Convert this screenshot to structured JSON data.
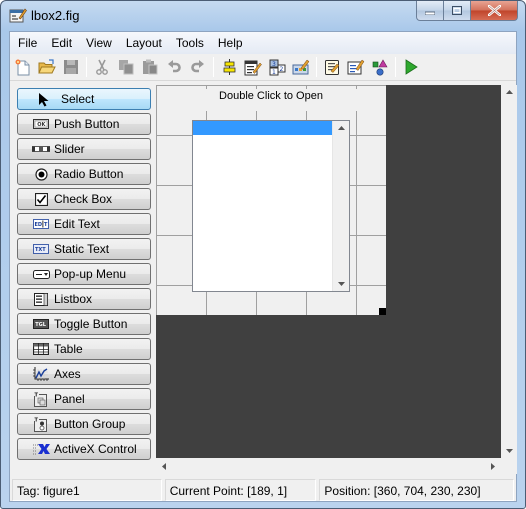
{
  "window": {
    "title": "lbox2.fig",
    "controls": {
      "minimize": "minimize",
      "maximize": "maximize",
      "close": "close"
    }
  },
  "menubar": {
    "items": [
      {
        "label": "File"
      },
      {
        "label": "Edit"
      },
      {
        "label": "View"
      },
      {
        "label": "Layout"
      },
      {
        "label": "Tools"
      },
      {
        "label": "Help"
      }
    ]
  },
  "toolbar": {
    "groups": [
      [
        {
          "name": "new-figure",
          "icon": "new-file-icon",
          "enabled": true
        },
        {
          "name": "open",
          "icon": "folder-open-icon",
          "enabled": true
        },
        {
          "name": "save",
          "icon": "save-icon",
          "enabled": false
        }
      ],
      [
        {
          "name": "cut",
          "icon": "scissors-icon",
          "enabled": false
        },
        {
          "name": "copy",
          "icon": "copy-icon",
          "enabled": false
        },
        {
          "name": "paste",
          "icon": "paste-icon",
          "enabled": false
        },
        {
          "name": "undo",
          "icon": "undo-icon",
          "enabled": false
        },
        {
          "name": "redo",
          "icon": "redo-icon",
          "enabled": false
        }
      ],
      [
        {
          "name": "align-objects",
          "icon": "align-icon",
          "enabled": true
        },
        {
          "name": "menu-editor",
          "icon": "menu-editor-icon",
          "enabled": true
        },
        {
          "name": "tab-order-editor",
          "icon": "tab-order-icon",
          "enabled": true
        },
        {
          "name": "toolbar-editor",
          "icon": "toolbar-editor-icon",
          "enabled": true
        }
      ],
      [
        {
          "name": "editor",
          "icon": "m-file-editor-icon",
          "enabled": true
        },
        {
          "name": "property-inspector",
          "icon": "property-inspector-icon",
          "enabled": true
        },
        {
          "name": "object-browser",
          "icon": "object-browser-icon",
          "enabled": true
        }
      ],
      [
        {
          "name": "run-figure",
          "icon": "run-icon",
          "enabled": true
        }
      ]
    ]
  },
  "palette": {
    "items": [
      {
        "label": "Select",
        "icon": "arrow-cursor-icon",
        "selected": true
      },
      {
        "label": "Push Button",
        "icon": "push-button-icon",
        "icon_text": "OK",
        "selected": false
      },
      {
        "label": "Slider",
        "icon": "slider-icon",
        "selected": false
      },
      {
        "label": "Radio Button",
        "icon": "radio-button-icon",
        "selected": false
      },
      {
        "label": "Check Box",
        "icon": "check-box-icon",
        "selected": false
      },
      {
        "label": "Edit Text",
        "icon": "edit-text-icon",
        "icon_text": "EDIT",
        "selected": false
      },
      {
        "label": "Static Text",
        "icon": "static-text-icon",
        "icon_text": "TXT",
        "selected": false
      },
      {
        "label": "Pop-up Menu",
        "icon": "popup-menu-icon",
        "selected": false
      },
      {
        "label": "Listbox",
        "icon": "listbox-icon",
        "selected": false
      },
      {
        "label": "Toggle Button",
        "icon": "toggle-button-icon",
        "icon_text": "TGL",
        "selected": false
      },
      {
        "label": "Table",
        "icon": "table-icon",
        "selected": false
      },
      {
        "label": "Axes",
        "icon": "axes-icon",
        "selected": false
      },
      {
        "label": "Panel",
        "icon": "panel-icon",
        "selected": false
      },
      {
        "label": "Button Group",
        "icon": "button-group-icon",
        "selected": false
      },
      {
        "label": "ActiveX Control",
        "icon": "activex-icon",
        "selected": false
      }
    ]
  },
  "canvas": {
    "figure_title": "Double Click to Open",
    "listbox": {
      "selected_index": 0,
      "items": [
        ""
      ]
    }
  },
  "statusbar": {
    "tag": "Tag: figure1",
    "current_point": "Current Point:  [189, 1]",
    "position": "Position: [360, 704, 230, 230]"
  },
  "colors": {
    "selection": "#3399ff",
    "canvas_background": "#404040",
    "run_green": "#2ea82e"
  }
}
